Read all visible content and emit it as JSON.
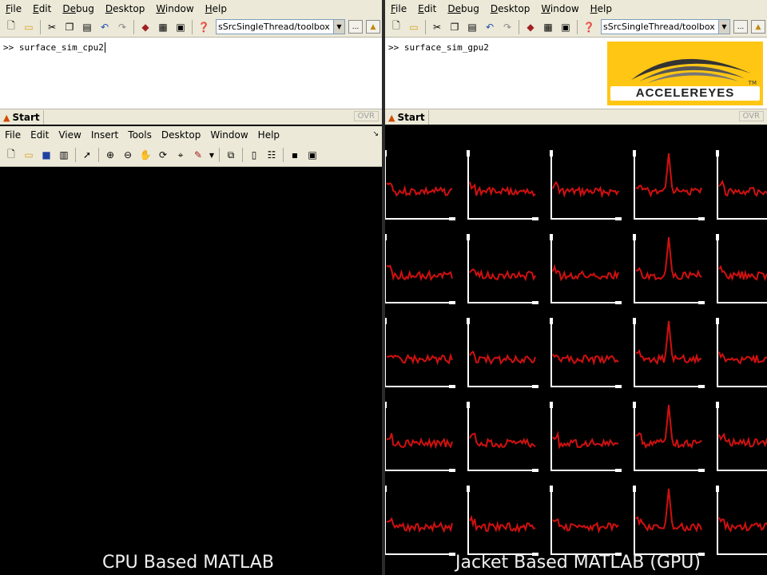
{
  "left_command_window": {
    "menu": [
      {
        "label": "File",
        "u": "F",
        "rest": "ile"
      },
      {
        "label": "Edit",
        "u": "E",
        "rest": "dit"
      },
      {
        "label": "Debug",
        "u": "De",
        "rest": "bug"
      },
      {
        "label": "Desktop",
        "u": "D",
        "rest": "esktop"
      },
      {
        "label": "Window",
        "u": "W",
        "rest": "indow"
      },
      {
        "label": "Help",
        "u": "H",
        "rest": "elp"
      }
    ],
    "current_folder": "sSrcSingleThread/toolbox",
    "browse_label": "...",
    "prompt": ">>",
    "command": "surface_sim_cpu2",
    "start_label": "Start",
    "ovr_label": "OVR"
  },
  "right_command_window": {
    "menu": [
      {
        "label": "File",
        "u": "F",
        "rest": "ile"
      },
      {
        "label": "Edit",
        "u": "E",
        "rest": "dit"
      },
      {
        "label": "Debug",
        "u": "De",
        "rest": "bug"
      },
      {
        "label": "Desktop",
        "u": "D",
        "rest": "esktop"
      },
      {
        "label": "Window",
        "u": "W",
        "rest": "indow"
      },
      {
        "label": "Help",
        "u": "H",
        "rest": "elp"
      }
    ],
    "current_folder": "sSrcSingleThread/toolbox",
    "browse_label": "...",
    "prompt": ">>",
    "command": "surface_sim_gpu2",
    "start_label": "Start",
    "ovr_label": "OVR"
  },
  "logo": {
    "text": "ACCELEREYES",
    "tm": "TM",
    "colors": {
      "background": "#ffc614",
      "swoosh": "#333333"
    }
  },
  "left_figure": {
    "menu": [
      {
        "label": "File",
        "u": "F",
        "rest": "ile"
      },
      {
        "label": "Edit",
        "u": "E",
        "rest": "dit"
      },
      {
        "label": "View",
        "u": "V",
        "rest": "iew"
      },
      {
        "label": "Insert",
        "u": "I",
        "rest": "nsert"
      },
      {
        "label": "Tools",
        "u": "T",
        "rest": "ools"
      },
      {
        "label": "Desktop",
        "u": "D",
        "rest": "esktop"
      },
      {
        "label": "Window",
        "u": "W",
        "rest": "indow"
      },
      {
        "label": "Help",
        "u": "H",
        "rest": "elp"
      }
    ]
  },
  "right_figure": {
    "grid_rows": 5,
    "grid_cols": 5,
    "line_color": "#d01010",
    "axes_color": "#ffffff",
    "cells": [
      [
        "flat",
        "flat",
        "flat",
        "peak",
        "flat"
      ],
      [
        "flat",
        "flat",
        "flat",
        "peak",
        "flat"
      ],
      [
        "flat",
        "flat",
        "flat",
        "peak",
        "flat"
      ],
      [
        "flat",
        "flat",
        "flat",
        "peak",
        "flat"
      ],
      [
        "flat",
        "flat",
        "flat",
        "peak",
        "flat"
      ]
    ]
  },
  "captions": {
    "left": "CPU Based MATLAB",
    "right": "Jacket Based MATLAB (GPU)"
  }
}
